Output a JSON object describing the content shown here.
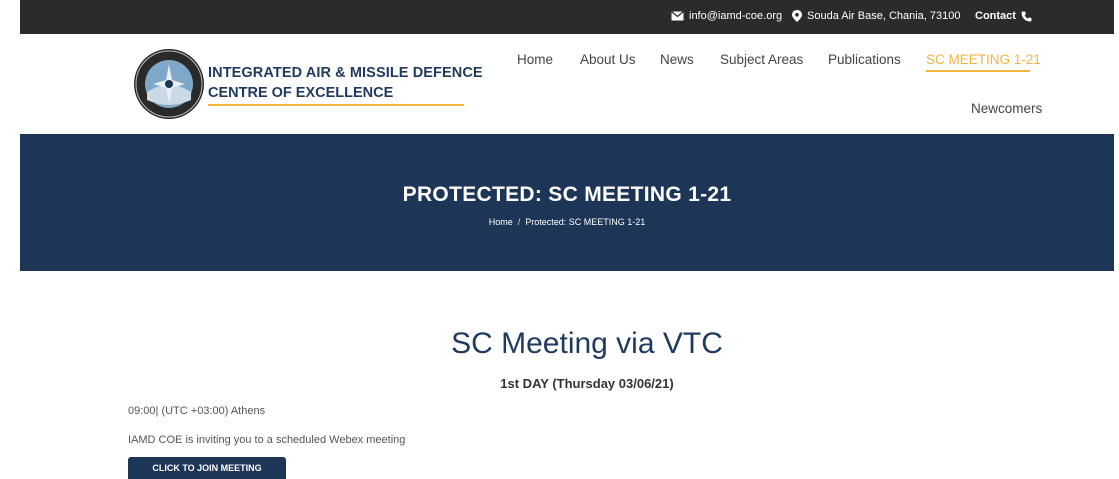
{
  "topbar": {
    "email": "info@iamd-coe.org",
    "address": "Souda Air Base, Chania, 73100",
    "contact": "Contact",
    "icons": {
      "email": "envelope-icon",
      "address": "map-pin-icon",
      "contact": "phone-icon"
    }
  },
  "brand": {
    "line1": "INTEGRATED AIR & MISSILE DEFENCE",
    "line2": "CENTRE OF EXCELLENCE",
    "accent_color": "#f2b43c",
    "navy_color": "#1d3557"
  },
  "nav": {
    "items": [
      {
        "label": "Home"
      },
      {
        "label": "About Us"
      },
      {
        "label": "News"
      },
      {
        "label": "Subject Areas"
      },
      {
        "label": "Publications"
      },
      {
        "label": "SC MEETING 1-21",
        "active": true
      },
      {
        "label": "Newcomers"
      }
    ]
  },
  "hero": {
    "title": "PROTECTED: SC MEETING 1-21",
    "breadcrumb": [
      "Home",
      "/",
      "Protected: SC MEETING 1-21"
    ]
  },
  "content": {
    "title": "SC Meeting via VTC",
    "subtitle": "1st DAY (Thursday 03/06/21)",
    "time": "09:00| (UTC +03:00) Athens",
    "invite": "IAMD COE is inviting you to a scheduled Webex meeting",
    "join_button": "CLICK TO JOIN MEETING"
  }
}
